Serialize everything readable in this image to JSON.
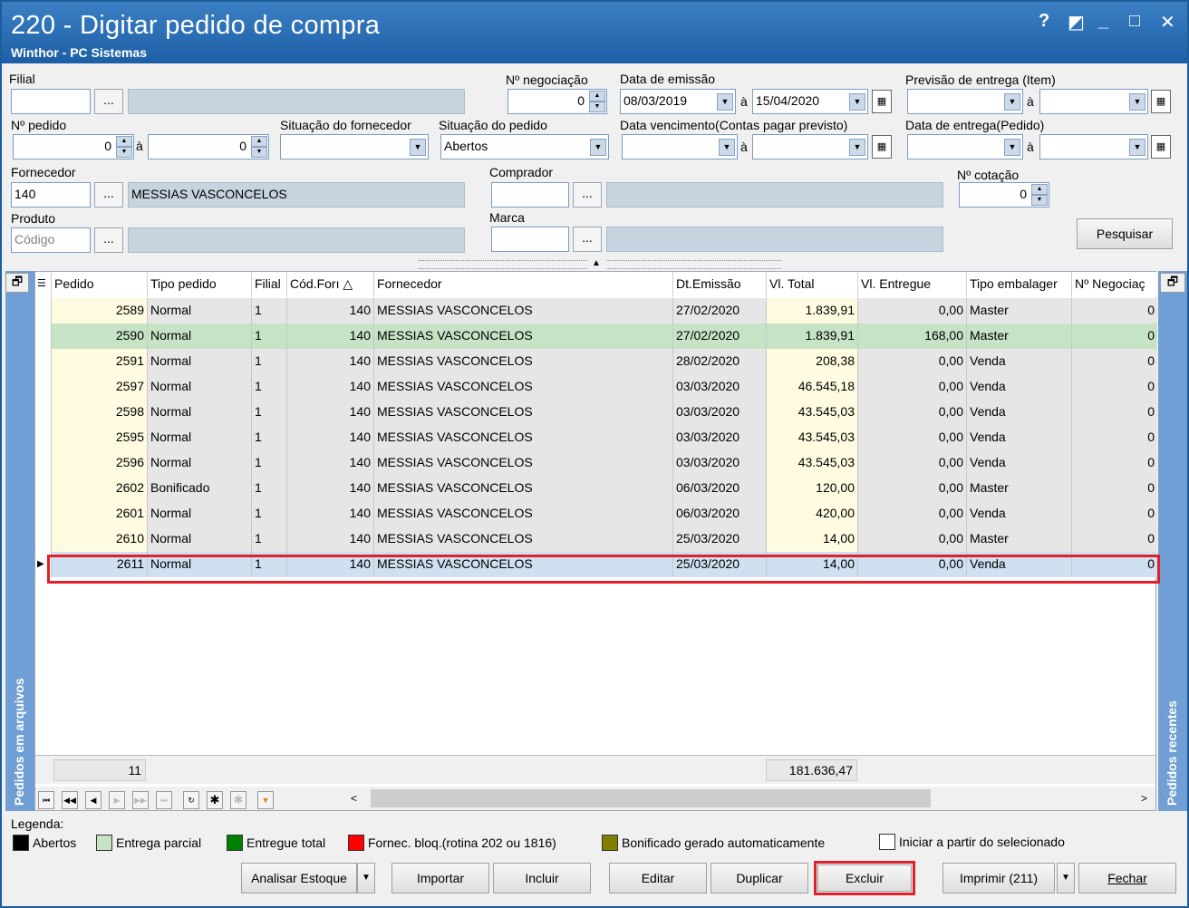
{
  "window": {
    "title": "220 - Digitar pedido de compra",
    "subtitle": "Winthor - PC Sistemas",
    "buttons": [
      "?",
      "◩",
      "_",
      "□",
      "✕"
    ]
  },
  "filters": {
    "filial": {
      "label": "Filial",
      "value": "",
      "desc": ""
    },
    "negociacao": {
      "label": "Nº negociação",
      "value": "0"
    },
    "data_emissao": {
      "label": "Data de emissão",
      "from": "08/03/2019",
      "sep": "à",
      "to": "15/04/2020"
    },
    "previsao": {
      "label": "Previsão  de entrega (Item)",
      "from": "",
      "sep": "à",
      "to": ""
    },
    "pedido": {
      "label": "Nº pedido",
      "from": "0",
      "sep": "à",
      "to": "0"
    },
    "sit_fornecedor": {
      "label": "Situação do fornecedor",
      "value": ""
    },
    "sit_pedido": {
      "label": "Situação do pedido",
      "value": "Abertos"
    },
    "data_venc": {
      "label": "Data vencimento(Contas pagar previsto)",
      "from": "",
      "sep": "à",
      "to": ""
    },
    "data_entrega": {
      "label": "Data de entrega(Pedido)",
      "from": "",
      "sep": "à",
      "to": ""
    },
    "fornecedor": {
      "label": "Fornecedor",
      "code": "140",
      "name": "MESSIAS VASCONCELOS"
    },
    "comprador": {
      "label": "Comprador",
      "code": "",
      "name": ""
    },
    "cotacao": {
      "label": "Nº cotação",
      "value": "0"
    },
    "produto": {
      "label": "Produto",
      "placeholder": "Código",
      "name": ""
    },
    "marca": {
      "label": "Marca",
      "code": "",
      "name": ""
    },
    "dots": "...",
    "search_button": "Pesquisar"
  },
  "grid": {
    "columns": [
      "Pedido",
      "Tipo pedido",
      "Filial",
      "Cód.Forı △",
      "Fornecedor",
      "Dt.Emissão",
      "Vl. Total",
      "Vl. Entregue",
      "Tipo embalager",
      "Nº Negociaç"
    ],
    "rows": [
      [
        "2589",
        "Normal",
        "1",
        "140",
        "MESSIAS VASCONCELOS",
        "27/02/2020",
        "1.839,91",
        "0,00",
        "Master",
        "0"
      ],
      [
        "2590",
        "Normal",
        "1",
        "140",
        "MESSIAS VASCONCELOS",
        "27/02/2020",
        "1.839,91",
        "168,00",
        "Master",
        "0"
      ],
      [
        "2591",
        "Normal",
        "1",
        "140",
        "MESSIAS VASCONCELOS",
        "28/02/2020",
        "208,38",
        "0,00",
        "Venda",
        "0"
      ],
      [
        "2597",
        "Normal",
        "1",
        "140",
        "MESSIAS VASCONCELOS",
        "03/03/2020",
        "46.545,18",
        "0,00",
        "Venda",
        "0"
      ],
      [
        "2598",
        "Normal",
        "1",
        "140",
        "MESSIAS VASCONCELOS",
        "03/03/2020",
        "43.545,03",
        "0,00",
        "Venda",
        "0"
      ],
      [
        "2595",
        "Normal",
        "1",
        "140",
        "MESSIAS VASCONCELOS",
        "03/03/2020",
        "43.545,03",
        "0,00",
        "Venda",
        "0"
      ],
      [
        "2596",
        "Normal",
        "1",
        "140",
        "MESSIAS VASCONCELOS",
        "03/03/2020",
        "43.545,03",
        "0,00",
        "Venda",
        "0"
      ],
      [
        "2602",
        "Bonificado",
        "1",
        "140",
        "MESSIAS VASCONCELOS",
        "06/03/2020",
        "120,00",
        "0,00",
        "Master",
        "0"
      ],
      [
        "2601",
        "Normal",
        "1",
        "140",
        "MESSIAS VASCONCELOS",
        "06/03/2020",
        "420,00",
        "0,00",
        "Venda",
        "0"
      ],
      [
        "2610",
        "Normal",
        "1",
        "140",
        "MESSIAS VASCONCELOS",
        "25/03/2020",
        "14,00",
        "0,00",
        "Master",
        "0"
      ],
      [
        "2611",
        "Normal",
        "1",
        "140",
        "MESSIAS VASCONCELOS",
        "25/03/2020",
        "14,00",
        "0,00",
        "Venda",
        "0"
      ]
    ],
    "footer_count": "11",
    "footer_total": "181.636,47",
    "left_panel": "Pedidos em arquivos",
    "right_panel": "Pedidos recentes",
    "partial_color": "#c6e3c6",
    "selected_color": "#cfe0f0"
  },
  "legend": {
    "title": "Legenda:",
    "items": [
      {
        "color": "#000000",
        "label": "Abertos"
      },
      {
        "color": "#c6e3c6",
        "label": "Entrega parcial"
      },
      {
        "color": "#008000",
        "label": "Entregue total"
      },
      {
        "color": "#ff0000",
        "label": "Fornec. bloq.(rotina 202 ou 1816)"
      },
      {
        "color": "#808000",
        "label": "Bonificado gerado automaticamente"
      }
    ],
    "checkbox": "Iniciar a partir do selecionado"
  },
  "buttons": {
    "analisar": "Analisar Estoque",
    "importar": "Importar",
    "incluir": "Incluir",
    "editar": "Editar",
    "duplicar": "Duplicar",
    "excluir": "Excluir",
    "imprimir": "Imprimir (211)",
    "fechar": "Fechar"
  }
}
